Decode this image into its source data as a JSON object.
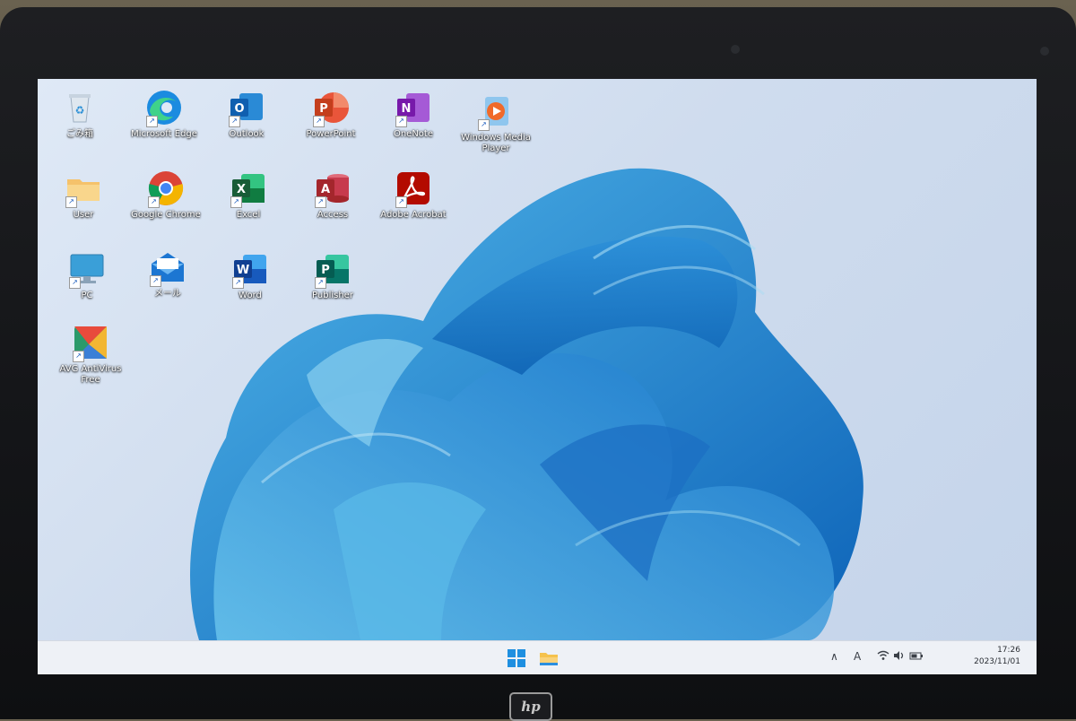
{
  "desktop": {
    "icons": [
      {
        "id": "recycle-bin",
        "label": "ごみ箱"
      },
      {
        "id": "microsoft-edge",
        "label": "Microsoft Edge"
      },
      {
        "id": "outlook",
        "label": "Outlook"
      },
      {
        "id": "powerpoint",
        "label": "PowerPoint"
      },
      {
        "id": "onenote",
        "label": "OneNote"
      },
      {
        "id": "windows-media-player",
        "label": "Windows Media Player"
      },
      {
        "id": "user",
        "label": "User"
      },
      {
        "id": "google-chrome",
        "label": "Google Chrome"
      },
      {
        "id": "excel",
        "label": "Excel"
      },
      {
        "id": "access",
        "label": "Access"
      },
      {
        "id": "adobe-acrobat",
        "label": "Adobe Acrobat"
      },
      {
        "id": "pc",
        "label": "PC"
      },
      {
        "id": "mail",
        "label": "メール"
      },
      {
        "id": "word",
        "label": "Word"
      },
      {
        "id": "publisher",
        "label": "Publisher"
      },
      {
        "id": "avg-antivirus",
        "label": "AVG AntiVirus Free"
      }
    ]
  },
  "taskbar": {
    "tray": {
      "chevron": "∧",
      "ime": "A"
    },
    "clock": {
      "time": "17:26",
      "date": "2023/11/01"
    }
  },
  "device": {
    "brand": "hp"
  },
  "colors": {
    "accent": "#0a7bd6",
    "wallpaper_bloom": "#1e8fd8"
  }
}
